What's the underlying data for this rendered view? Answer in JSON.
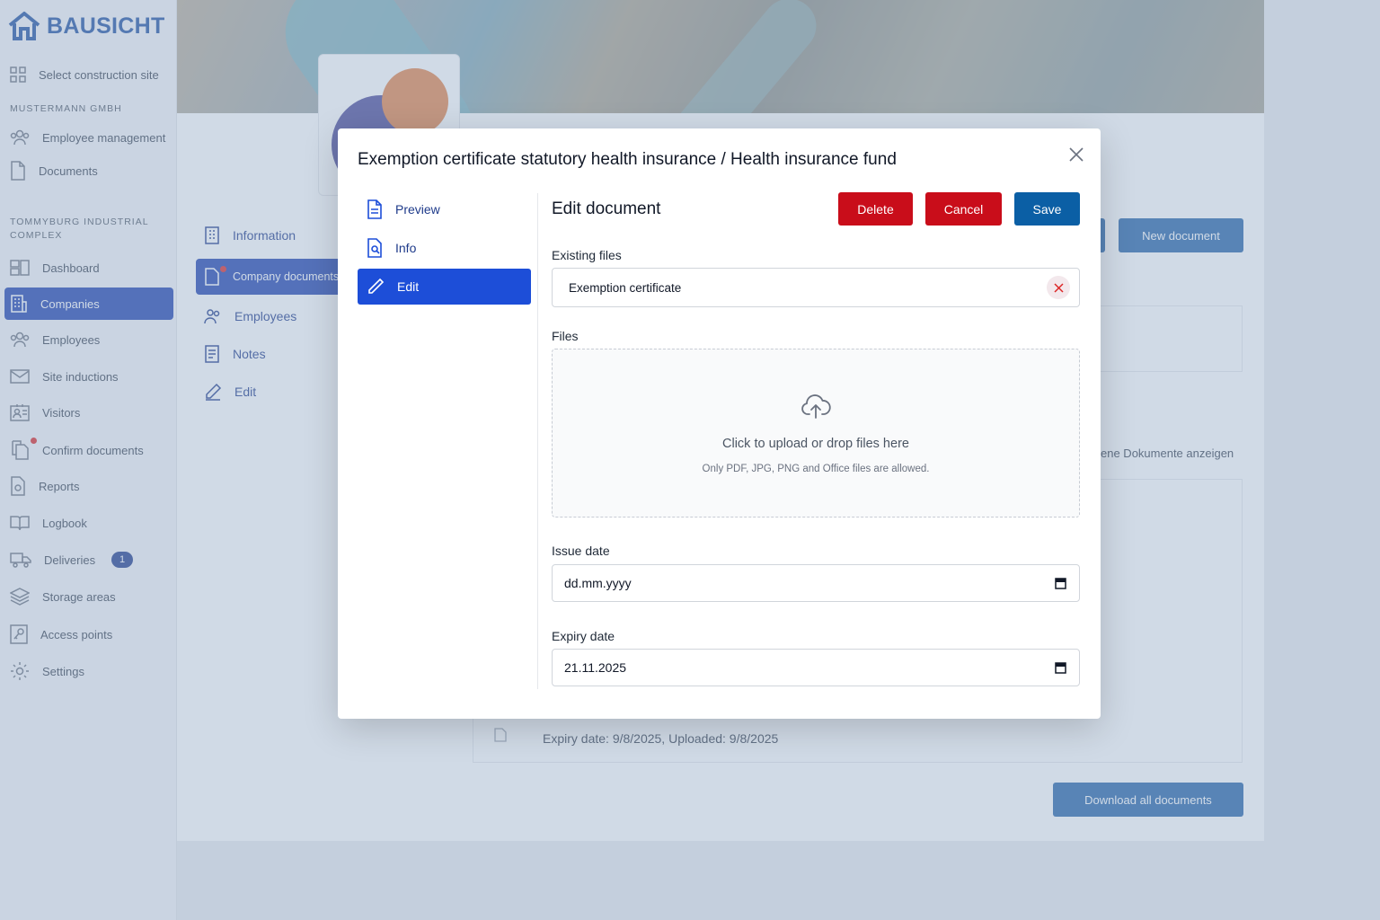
{
  "app": {
    "logo_text": "BAUSICHT"
  },
  "sidebar": {
    "select_site": "Select construction site",
    "company_section": "MUSTERMANN GMBH",
    "company_items": [
      "Employee management",
      "Documents"
    ],
    "site_section": "TOMMYBURG INDUSTRIAL COMPLEX",
    "items": [
      {
        "label": "Dashboard"
      },
      {
        "label": "Companies",
        "active": true
      },
      {
        "label": "Employees"
      },
      {
        "label": "Site inductions"
      },
      {
        "label": "Visitors"
      },
      {
        "label": "Confirm documents"
      },
      {
        "label": "Reports"
      },
      {
        "label": "Logbook"
      },
      {
        "label": "Deliveries",
        "badge": "1"
      },
      {
        "label": "Storage areas"
      },
      {
        "label": "Access points"
      },
      {
        "label": "Settings"
      }
    ]
  },
  "company_nav": {
    "items": [
      {
        "label": "Information"
      },
      {
        "label": "Company documents",
        "active": true
      },
      {
        "label": "Employees"
      },
      {
        "label": "Notes"
      },
      {
        "label": "Edit"
      }
    ]
  },
  "page": {
    "new_document": "New document",
    "show_hidden_partial": "ene Dokumente anzeigen",
    "row_meta": "Expiry date: 9/8/2025, Uploaded: 9/8/2025",
    "download_all": "Download all documents"
  },
  "modal": {
    "title": "Exemption certificate statutory health insurance / Health insurance fund",
    "nav": [
      {
        "label": "Preview",
        "icon": "document-icon"
      },
      {
        "label": "Info",
        "icon": "document-search-icon"
      },
      {
        "label": "Edit",
        "icon": "pencil-icon",
        "active": true
      }
    ],
    "edit_title": "Edit document",
    "buttons": {
      "delete": "Delete",
      "cancel": "Cancel",
      "save": "Save"
    },
    "existing_files_label": "Existing files",
    "existing_file": "Exemption certificate",
    "files_label": "Files",
    "upload_main": "Click to upload or drop files here",
    "upload_sub": "Only PDF, JPG, PNG and Office files are allowed.",
    "issue_date_label": "Issue date",
    "issue_date_value": "dd.mm.yyyy",
    "expiry_date_label": "Expiry date",
    "expiry_date_value": "21.11.2025"
  },
  "colors": {
    "primary": "#1d4ed8",
    "danger": "#c90d1a",
    "save": "#0b5fa5"
  }
}
